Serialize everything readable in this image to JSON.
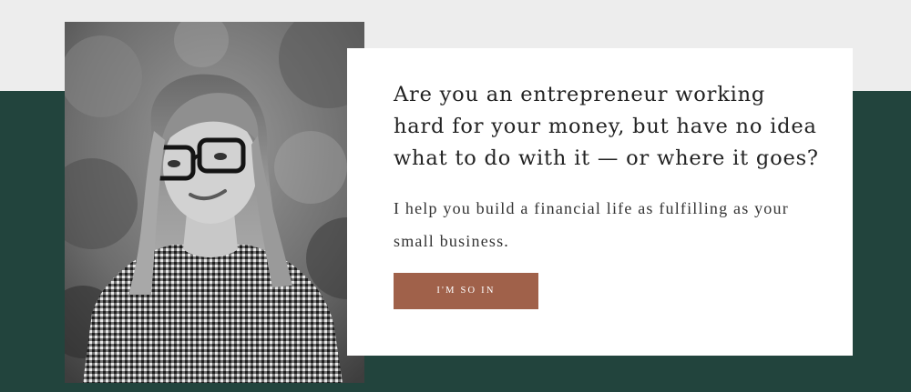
{
  "hero": {
    "headline": "Are you an entrepreneur working hard for your money, but have no idea what to do with it — or where it goes?",
    "subtext": "I help you build a financial life as fulfilling as your small business.",
    "cta_label": "I'M SO IN"
  },
  "colors": {
    "top_band": "#ededed",
    "green_band": "#22443d",
    "card": "#ffffff",
    "button": "#a0614a"
  }
}
